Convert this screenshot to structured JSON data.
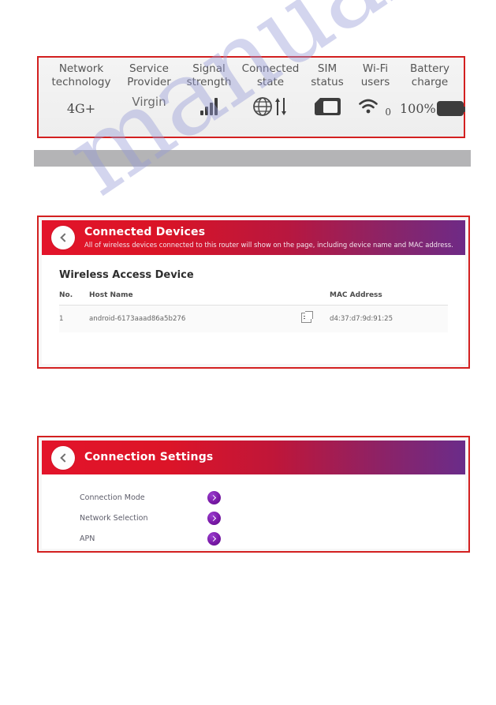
{
  "status_table": {
    "columns": [
      {
        "label_line1": "Network",
        "label_line2": "technology",
        "value": "4G+",
        "icon": ""
      },
      {
        "label_line1": "Service",
        "label_line2": "Provider",
        "value": "Virgin",
        "icon": ""
      },
      {
        "label_line1": "Signal",
        "label_line2": "strength",
        "value": "",
        "icon": "signal-bars-icon"
      },
      {
        "label_line1": "Connected",
        "label_line2": "state",
        "value": "",
        "icon": "globe-data-transfer-icon"
      },
      {
        "label_line1": "SIM",
        "label_line2": "status",
        "value": "",
        "icon": "sim-card-icon"
      },
      {
        "label_line1": "Wi-Fi",
        "label_line2": "users",
        "value": "0",
        "icon": "wifi-icon"
      },
      {
        "label_line1": "Battery",
        "label_line2": "charge",
        "value": "100%",
        "icon": "battery-full-icon"
      }
    ]
  },
  "connected_devices": {
    "back_label": "Back",
    "title": "Connected Devices",
    "subtitle": "All of wireless devices connected to this router will show on the page, including device name and MAC address.",
    "section_title": "Wireless Access Device",
    "table": {
      "headers": [
        "No.",
        "Host Name",
        "",
        "MAC Address"
      ],
      "rows": [
        {
          "no": "1",
          "host_name": "android-6173aaad86a5b276",
          "action_icon": "edit-icon",
          "mac_address": "d4:37:d7:9d:91:25"
        }
      ]
    }
  },
  "connection_settings": {
    "back_label": "Back",
    "title": "Connection Settings",
    "items": [
      {
        "label": "Connection Mode",
        "chevron": "chevron-right-icon"
      },
      {
        "label": "Network Selection",
        "chevron": "chevron-right-icon"
      },
      {
        "label": "APN",
        "chevron": "chevron-right-icon"
      }
    ]
  },
  "watermark": {
    "text": "manualshive.com"
  },
  "colors": {
    "border_red": "#d32020",
    "header_red": "#e3142a",
    "header_purple": "#6e2a86",
    "gray_bar": "#b4b4b6",
    "chevron_purple": "#7a1aa8"
  }
}
